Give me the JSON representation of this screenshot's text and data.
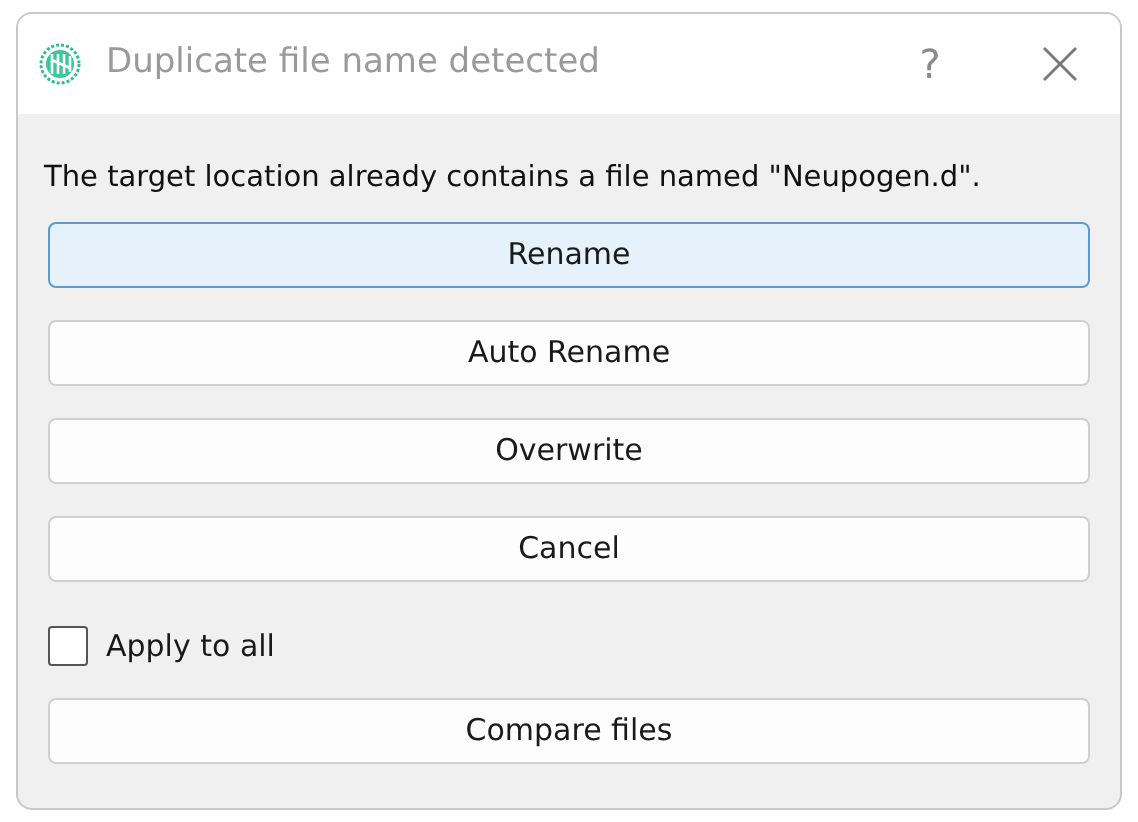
{
  "window": {
    "title": "Duplicate file name detected",
    "help": "?"
  },
  "message": "The target location already contains a file named \"Neupogen.d\".",
  "buttons": [
    {
      "label": "Rename",
      "focused": true
    },
    {
      "label": "Auto Rename",
      "focused": false
    },
    {
      "label": "Overwrite",
      "focused": false
    },
    {
      "label": "Cancel",
      "focused": false
    }
  ],
  "apply_to_all": {
    "label": "Apply to all",
    "checked": false
  },
  "compare_button": {
    "label": "Compare files",
    "focused": false
  }
}
